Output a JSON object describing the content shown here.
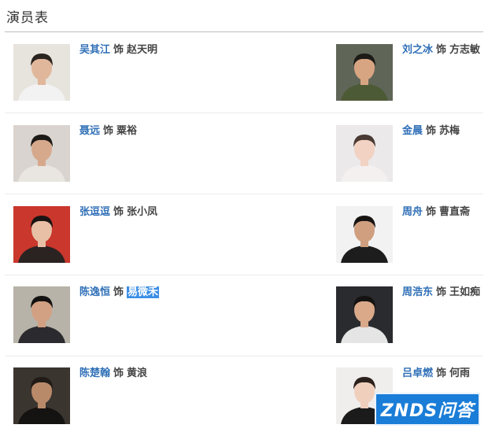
{
  "page": {
    "title": "演员表"
  },
  "cast": [
    {
      "actor": "吴其江",
      "sep": "饰",
      "role": "赵天明",
      "photo": {
        "bg": "#e7e3dd",
        "skin": "#e0b79a",
        "hair": "#2a2420",
        "cloth": "#f2f2f2"
      }
    },
    {
      "actor": "刘之冰",
      "sep": "饰",
      "role": "方志敏",
      "photo": {
        "bg": "#5f6658",
        "skin": "#d8a583",
        "hair": "#1d1b18",
        "cloth": "#4d5a36"
      }
    },
    {
      "actor": "聂远",
      "sep": "饰",
      "role": "粟裕",
      "photo": {
        "bg": "#d9d4cf",
        "skin": "#d6a98c",
        "hair": "#1c1a17",
        "cloth": "#e9e5e0"
      }
    },
    {
      "actor": "金晨",
      "sep": "饰",
      "role": "苏梅",
      "photo": {
        "bg": "#ebe9ea",
        "skin": "#f1d2c3",
        "hair": "#4a3a33",
        "cloth": "#f3f0ef"
      }
    },
    {
      "actor": "张逗逗",
      "sep": "饰",
      "role": "张小凤",
      "photo": {
        "bg": "#c9372d",
        "skin": "#e7c0a6",
        "hair": "#1a1414",
        "cloth": "#2b2222"
      }
    },
    {
      "actor": "周舟",
      "sep": "饰",
      "role": "曹直斋",
      "photo": {
        "bg": "#f2f2f2",
        "skin": "#cf9f80",
        "hair": "#161412",
        "cloth": "#1d1d1d"
      }
    },
    {
      "actor": "陈逸恒",
      "sep": "饰",
      "role": "易微禾",
      "selected": true,
      "photo": {
        "bg": "#b7b3a8",
        "skin": "#d2a082",
        "hair": "#141210",
        "cloth": "#2b2a2e"
      }
    },
    {
      "actor": "周浩东",
      "sep": "饰",
      "role": "王如痴",
      "photo": {
        "bg": "#2a2b2e",
        "skin": "#d9a98a",
        "hair": "#151311",
        "cloth": "#e5e5e5"
      }
    },
    {
      "actor": "陈楚翰",
      "sep": "饰",
      "role": "黄浪",
      "photo": {
        "bg": "#3b3530",
        "skin": "#b98a6a",
        "hair": "#201b17",
        "cloth": "#151311"
      }
    },
    {
      "actor": "吕卓燃",
      "sep": "饰",
      "role": "何雨",
      "photo": {
        "bg": "#efeeed",
        "skin": "#f0d0bd",
        "hair": "#2b201c",
        "cloth": "#1b1b1b"
      }
    }
  ],
  "watermark": {
    "text": "ZNDS问答",
    "color": "#1a7dd7"
  }
}
